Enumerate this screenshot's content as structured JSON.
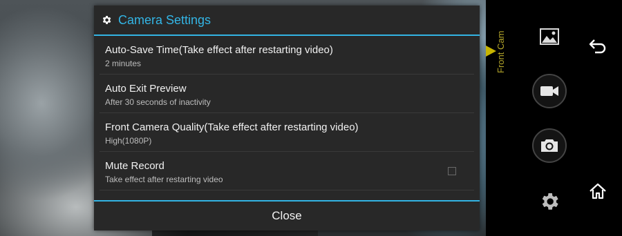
{
  "dialog": {
    "title": "Camera Settings",
    "icon": "gear-icon",
    "accent_color": "#33b5e5",
    "settings": [
      {
        "title": "Auto-Save Time(Take effect after restarting video)",
        "summary": "2 minutes"
      },
      {
        "title": "Auto Exit Preview",
        "summary": "After 30 seconds of inactivity"
      },
      {
        "title": "Front Camera Quality(Take effect after restarting video)",
        "summary": "High(1080P)"
      },
      {
        "title": "Mute Record",
        "summary": "Take effect after restarting video",
        "checked": false
      }
    ],
    "close_label": "Close"
  },
  "control_panel": {
    "camera_label": "Front Cam",
    "indicator_color": "#c7b400",
    "icons": [
      "gallery-icon",
      "video-camera-icon",
      "photo-camera-icon",
      "settings-gear-icon",
      "back-arrow-icon",
      "home-icon"
    ]
  }
}
